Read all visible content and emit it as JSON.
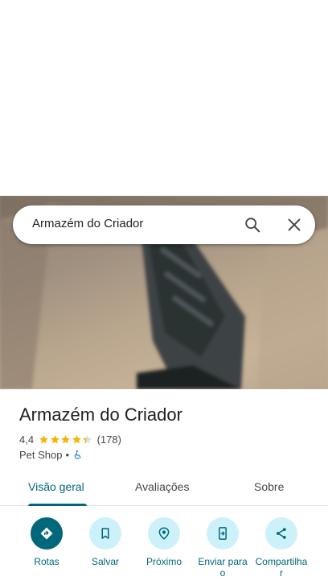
{
  "search": {
    "query": "Armazém do Criador"
  },
  "place": {
    "name": "Armazém do Criador",
    "rating": "4,4",
    "rating_value": 4.4,
    "review_count": "(178)",
    "category": "Pet Shop",
    "separator": "•"
  },
  "tabs": [
    {
      "label": "Visão geral",
      "selected": true
    },
    {
      "label": "Avaliações",
      "selected": false
    },
    {
      "label": "Sobre",
      "selected": false
    }
  ],
  "actions": [
    {
      "label": "Rotas",
      "icon": "directions-icon"
    },
    {
      "label": "Salvar",
      "icon": "bookmark-icon"
    },
    {
      "label": "Próximo",
      "icon": "nearby-icon"
    },
    {
      "label": "Enviar para o",
      "icon": "send-to-phone-icon"
    },
    {
      "label": "Compartilhar",
      "icon": "share-icon"
    }
  ],
  "colors": {
    "accent": "#00687a",
    "chip_bg": "#cdf1fb",
    "star": "#f4b400"
  }
}
